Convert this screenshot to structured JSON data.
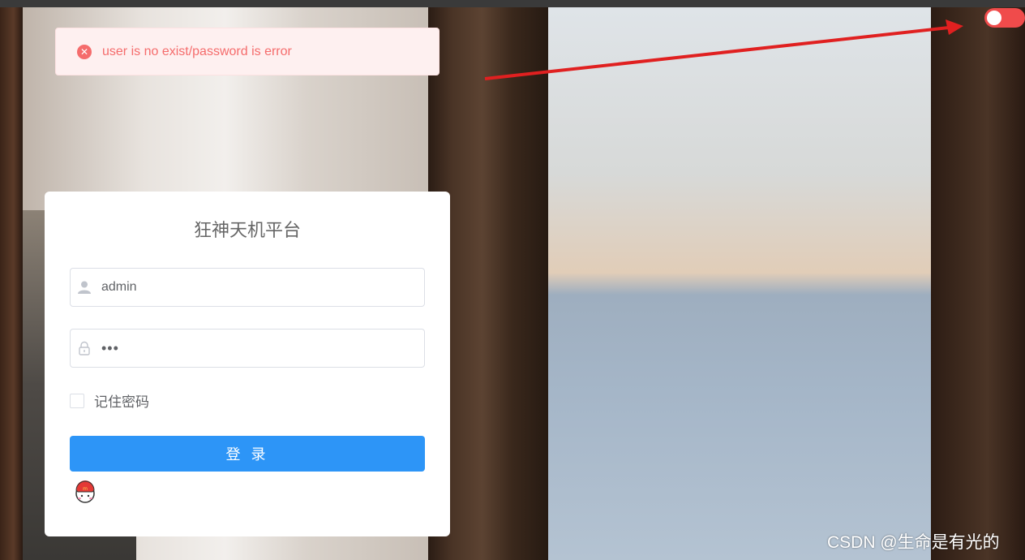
{
  "alert": {
    "message": "user is no exist/password is error",
    "icon": "close-circle-icon"
  },
  "toggle": {
    "state": "off",
    "color": "#f04b4b"
  },
  "login": {
    "title": "狂神天机平台",
    "username_value": "admin",
    "password_value": "•••",
    "remember_label": "记住密码",
    "remember_checked": false,
    "submit_label": "登 录"
  },
  "watermark": {
    "text": "CSDN @生命是有光的"
  },
  "colors": {
    "primary": "#2d95f7",
    "error": "#f56c6c",
    "error_bg": "#fef0f0",
    "annotation_arrow": "#e02020"
  }
}
